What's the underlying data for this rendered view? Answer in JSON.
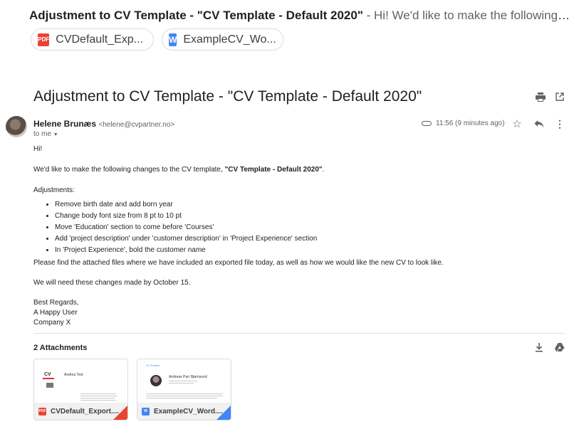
{
  "thread": {
    "subject_bold": "Adjustment to CV Template - \"CV Template - Default 2020\"",
    "snippet": " - Hi! We'd like to make the following ch..."
  },
  "chips": [
    {
      "label": "CVDefault_Exp...",
      "type": "pdf",
      "icon_text": "PDF"
    },
    {
      "label": "ExampleCV_Wo...",
      "type": "word",
      "icon_text": "W"
    }
  ],
  "message": {
    "subject": "Adjustment to CV Template - \"CV Template - Default 2020\"",
    "sender_name": "Helene Brunæs",
    "sender_email": "<helene@cvpartner.no>",
    "to": "to me",
    "time": "11:56 (9 minutes ago)",
    "greeting": "Hi!",
    "intro_prefix": "We'd like to make the following changes to the CV template, ",
    "intro_bold": "\"CV Template - Default 2020\"",
    "intro_suffix": ".",
    "adjustments_heading": "Adjustments:",
    "adjustments": [
      "Remove birth date and add born year",
      "Change body font size from 8 pt to 10 pt",
      "Move 'Education' section to come before 'Courses'",
      "Add 'project description' under 'customer description' in 'Project Experience' section",
      "In 'Project Experience', bold the customer name"
    ],
    "attached_note": "Please find the attached files where we have included an exported file today, as well as how we would like the new CV to look like.",
    "deadline": "We will need these changes made by October 15.",
    "signoff": [
      "Best Regards,",
      "A Happy User",
      "Company X"
    ]
  },
  "attachments": {
    "title": "2 Attachments",
    "items": [
      {
        "name": "CVDefault_Export....",
        "type": "pdf",
        "icon_text": "PDF",
        "thumb_name": "Andrea Test"
      },
      {
        "name": "ExampleCV_Word....",
        "type": "word",
        "icon_text": "W",
        "thumb_name": "Andreas Parr Bjørnsund",
        "thumb_logo": "CV Partner"
      }
    ]
  },
  "icons": [
    "print-icon",
    "open-in-new-icon",
    "attachment-icon",
    "star-icon",
    "reply-icon",
    "more-icon",
    "download-icon",
    "drive-icon"
  ],
  "colors": {
    "pdf": "#ea4335",
    "word": "#4285f4",
    "text": "#202124",
    "muted": "#5f6368"
  }
}
